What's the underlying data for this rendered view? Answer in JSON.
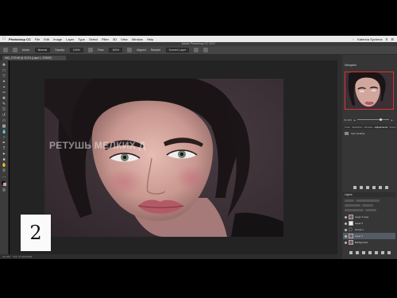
{
  "menubar": {
    "apple_icon": "apple-icon",
    "items": [
      "Photoshop CC",
      "File",
      "Edit",
      "Image",
      "Layer",
      "Type",
      "Select",
      "Filter",
      "3D",
      "View",
      "Window",
      "Help"
    ],
    "user": "Katerina Sycheva"
  },
  "app_title": "Adobe Photoshop CC 2017",
  "options_bar": {
    "mode_label": "Mode:",
    "mode_value": "Normal",
    "opacity_label": "Opacity:",
    "opacity_value": "100%",
    "flow_label": "Flow:",
    "flow_value": "100%",
    "aligned_label": "Aligned",
    "sample_label": "Sample:",
    "sample_value": "Current Layer"
  },
  "document_tab": "IMG_2729.tiff @ 33,3% (Layer 1, RGB/8*)",
  "canvas": {
    "watermark_text": "РЕТУШЬ МЕЛКИХ Д"
  },
  "badge_number": "2",
  "status_bar": {
    "zoom": "33,33%",
    "doc_info": "Doc: 57,4M/126M"
  },
  "right_panel": {
    "navigator_title": "Navigator",
    "zoom_value": "33,33%",
    "panel_tabs": [
      "Color",
      "Swatches",
      "Libraries",
      "Adjustments",
      "Styles"
    ],
    "history_item": "Spot Healing",
    "layers_title": "Layers",
    "layers": [
      {
        "name": "Layer 2 copy",
        "type": "image",
        "selected": false
      },
      {
        "name": "Layer 2",
        "type": "image",
        "selected": false
      },
      {
        "name": "Group 1",
        "type": "folder",
        "selected": false
      },
      {
        "name": "Layer 1",
        "type": "image",
        "selected": true
      },
      {
        "name": "Background",
        "type": "image",
        "selected": false
      }
    ]
  },
  "colors": {
    "accent_selection": "#555c66",
    "navigator_frame": "#dd3333"
  }
}
